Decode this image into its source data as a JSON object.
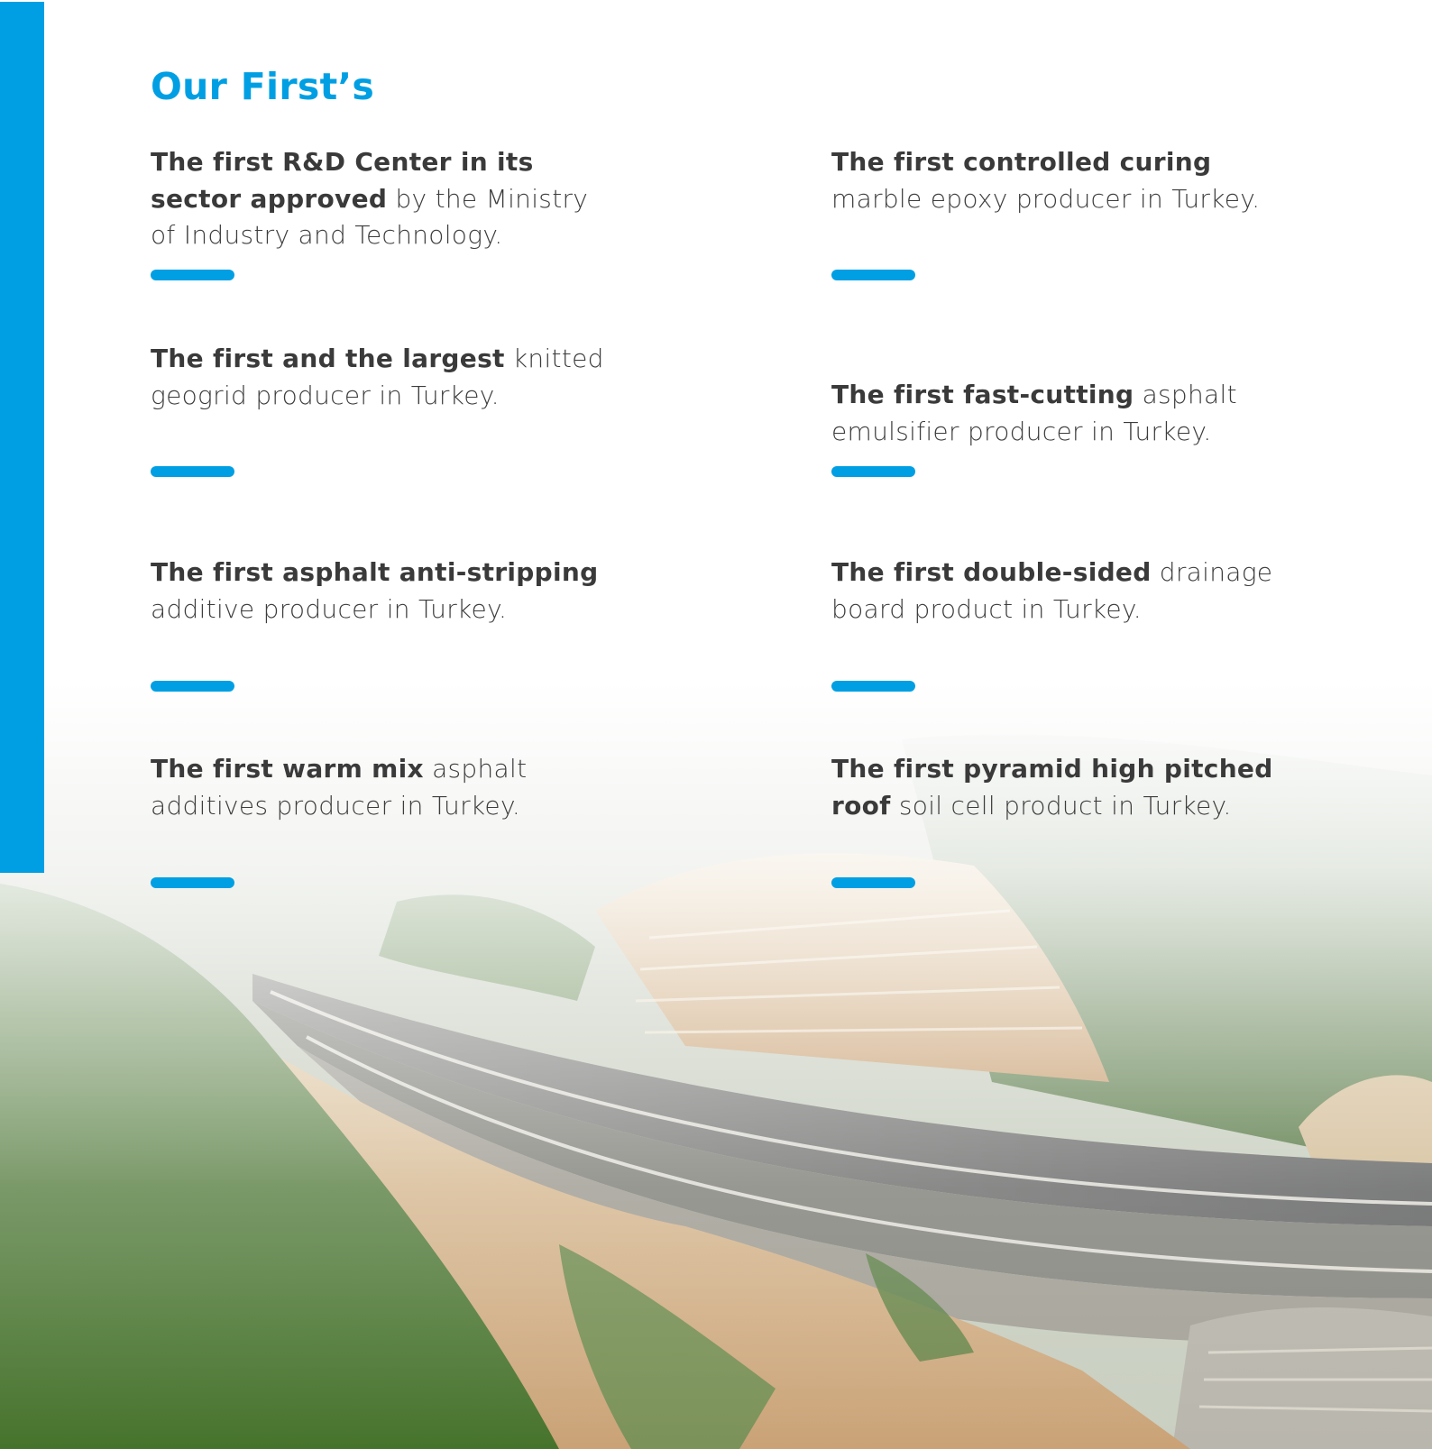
{
  "page": {
    "heading": "Our First’s",
    "accent_color": "#009fe3",
    "background_image": "aerial-highway-forest-photo"
  },
  "firsts": [
    {
      "bold": "The first R&D Center in its sector approved",
      "rest": " by the Ministry of Industry and Technology."
    },
    {
      "bold": "The first controlled curing",
      "rest": " marble epoxy producer in Turkey."
    },
    {
      "bold": "The first and the largest",
      "rest": " knitted geogrid producer in Turkey."
    },
    {
      "bold": "The first fast-cutting",
      "rest": " asphalt emulsifier producer in Turkey."
    },
    {
      "bold": "The first asphalt anti-stripping",
      "rest": " additive producer in Turkey."
    },
    {
      "bold": "The first double-sided",
      "rest": " drainage board product in Turkey."
    },
    {
      "bold": "The first warm mix",
      "rest": " asphalt additives producer in Turkey."
    },
    {
      "bold": "The first pyramid high pitched roof",
      "rest": " soil cell product in Turkey."
    }
  ]
}
